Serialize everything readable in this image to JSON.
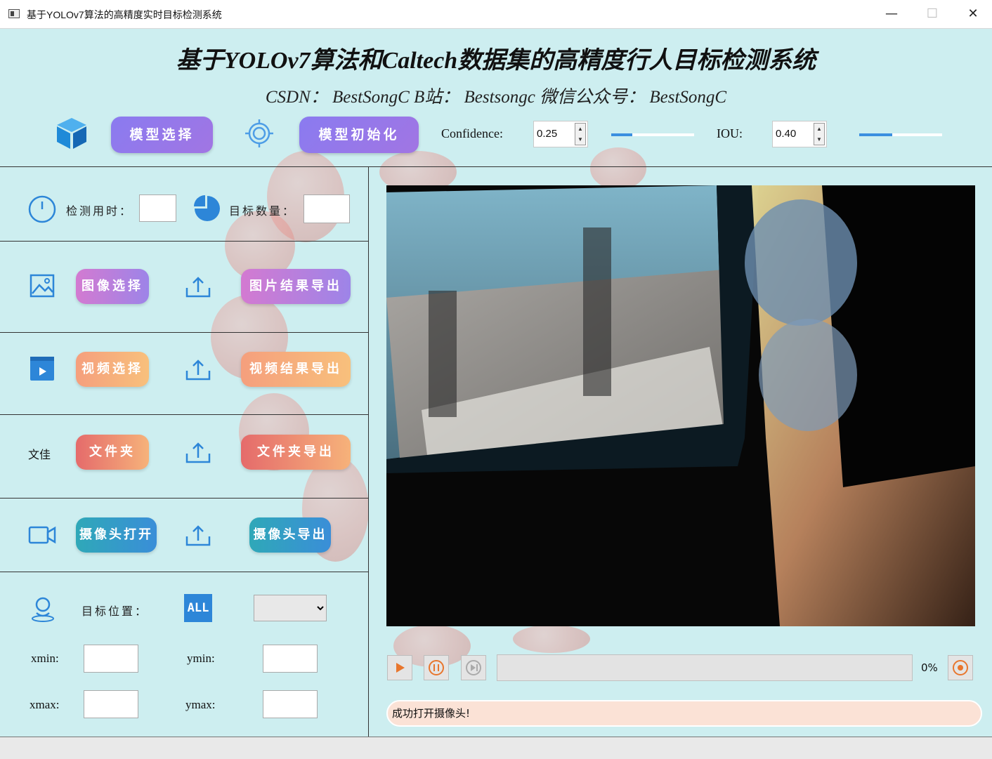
{
  "window": {
    "title": "基于YOLOv7算法的高精度实时目标检测系统",
    "minimize": "—",
    "maximize": "☐",
    "close": "✕"
  },
  "header": {
    "title": "基于YOLOv7算法和Caltech数据集的高精度行人目标检测系统",
    "subtitle": "CSDN：  BestSongC     B站：  Bestsongc     微信公众号：  BestSongC"
  },
  "toolbar": {
    "model_select": "模型选择",
    "model_init": "模型初始化",
    "confidence_label": "Confidence:",
    "confidence_value": "0.25",
    "confidence_level": 0.25,
    "iou_label": "IOU:",
    "iou_value": "0.40",
    "iou_level": 0.4,
    "accent_color": "#3b8fe0"
  },
  "stats": {
    "time_label": "检测用时：",
    "count_label": "目标数量："
  },
  "image_row": {
    "select": "图像选择",
    "export": "图片结果导出"
  },
  "video_row": {
    "select": "视频选择",
    "export": "视频结果导出"
  },
  "folder_row": {
    "label": "文佳",
    "select": "文件夹",
    "export": "文件夹导出"
  },
  "camera_row": {
    "open": "摄像头打开",
    "export": "摄像头导出"
  },
  "position": {
    "label": "目标位置：",
    "all_badge": "ALL",
    "xmin_label": "xmin:",
    "ymin_label": "ymin:",
    "xmax_label": "xmax:",
    "ymax_label": "ymax:"
  },
  "player": {
    "progress_text": "0%",
    "progress": 0,
    "status": "成功打开摄像头!"
  },
  "icons": [
    "cube-icon",
    "target-icon",
    "clock-icon",
    "pie-icon",
    "image-icon",
    "upload-icon",
    "video-file-icon",
    "camera-icon",
    "user-pin-icon",
    "play-icon",
    "pause-icon",
    "stop-icon",
    "record-icon"
  ]
}
